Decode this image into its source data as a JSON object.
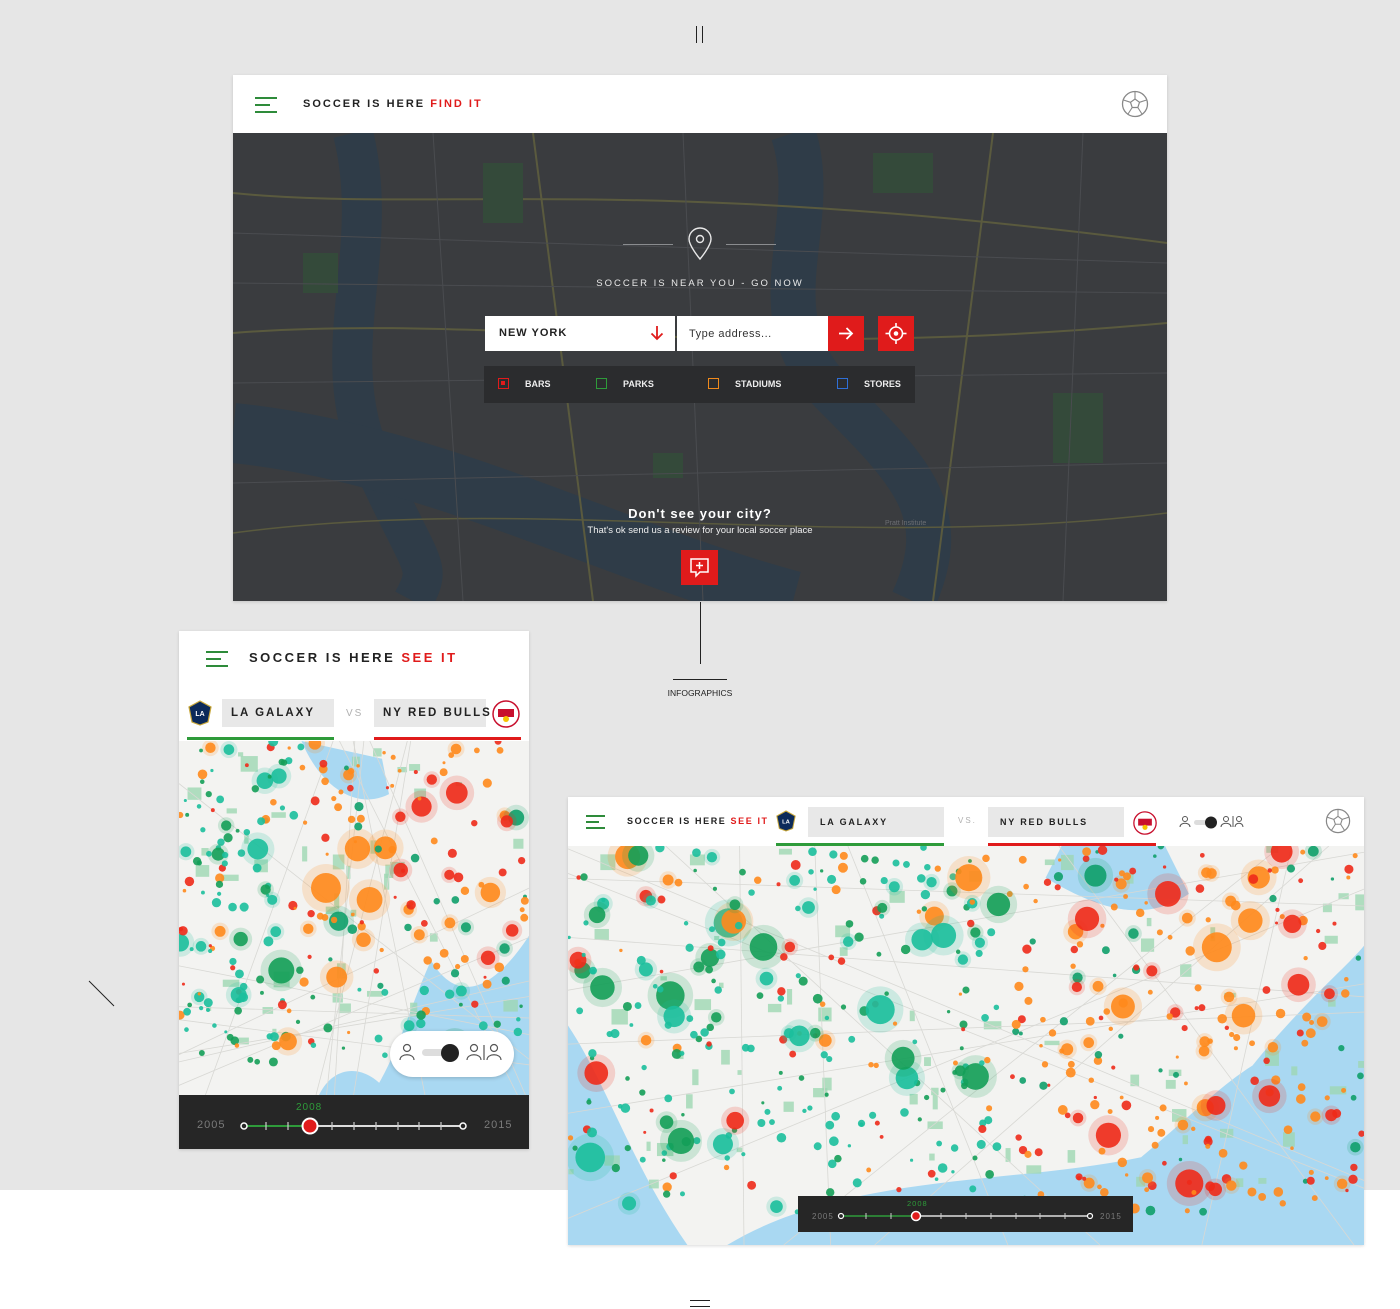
{
  "finder": {
    "brand_prefix": "SOCCER IS HERE",
    "brand_accent": "FIND IT",
    "tagline": "SOCCER IS NEAR YOU - GO NOW",
    "city_value": "NEW YORK",
    "address_placeholder": "Type address...",
    "filters": [
      {
        "label": "BARS",
        "color": "#e01b1b",
        "checked": true
      },
      {
        "label": "PARKS",
        "color": "#2e9b3a",
        "checked": false
      },
      {
        "label": "STADIUMS",
        "color": "#f08a1c",
        "checked": false
      },
      {
        "label": "STORES",
        "color": "#2f6fd6",
        "checked": false
      }
    ],
    "no_city_title": "Don't see your city?",
    "no_city_subtitle": "That's ok send us a review for your local soccer place",
    "map_credit": "Pratt Institute"
  },
  "annotation": {
    "label": "INFOGRAPHICS"
  },
  "infographic": {
    "brand_prefix": "SOCCER IS HERE",
    "brand_accent": "SEE IT",
    "brand_accent_right": "SEE IT",
    "team_a": "LA GALAXY",
    "team_b": "NY RED BULLS",
    "vs_label": "VS",
    "vs_label_short": "VS.",
    "team_a_color": "#2e9b3a",
    "team_b_color": "#e01b1b",
    "timeline": {
      "start_year": "2005",
      "end_year": "2015",
      "current_year": "2008"
    }
  },
  "icons": {
    "menu": "hamburger-menu-icon",
    "ball": "soccer-ball-icon",
    "pin": "location-pin-icon",
    "go": "arrow-right-icon",
    "locate": "crosshair-icon",
    "review": "add-comment-icon",
    "dropdown": "arrow-down-icon",
    "team_a_logo": "la-galaxy-logo",
    "team_b_logo": "red-bulls-logo",
    "person": "person-icon"
  }
}
